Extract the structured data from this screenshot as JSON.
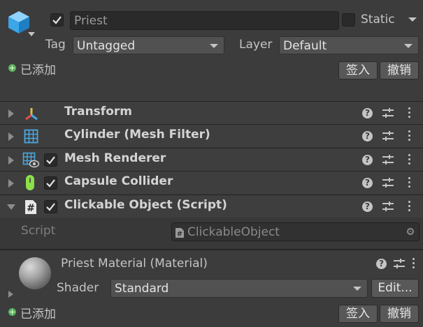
{
  "header": {
    "object_name": "Priest",
    "active": true,
    "static_label": "Static",
    "static": false,
    "tag_label": "Tag",
    "tag_value": "Untagged",
    "layer_label": "Layer",
    "layer_value": "Default",
    "added_label": "已添加",
    "checkin_label": "签入",
    "undo_label": "撤销"
  },
  "components": [
    {
      "name": "Transform",
      "icon": "transform-icon",
      "has_checkbox": false,
      "expanded": false
    },
    {
      "name": "Cylinder (Mesh Filter)",
      "icon": "mesh-filter-icon",
      "has_checkbox": false,
      "expanded": false
    },
    {
      "name": "Mesh Renderer",
      "icon": "mesh-renderer-icon",
      "has_checkbox": true,
      "enabled": true,
      "expanded": false
    },
    {
      "name": "Capsule Collider",
      "icon": "capsule-collider-icon",
      "has_checkbox": true,
      "enabled": true,
      "expanded": false
    },
    {
      "name": "Clickable Object (Script)",
      "icon": "script-icon",
      "has_checkbox": true,
      "enabled": true,
      "expanded": true
    }
  ],
  "script_field": {
    "label": "Script",
    "value": "ClickableObject"
  },
  "material": {
    "title": "Priest Material (Material)",
    "shader_label": "Shader",
    "shader_value": "Standard",
    "edit_label": "Edit...",
    "added_label": "已添加",
    "checkin_label": "签入",
    "undo_label": "撤销"
  },
  "colors": {
    "background": "#383838",
    "accent_blue": "#4aa8e0",
    "added_green": "#5ab35a"
  }
}
